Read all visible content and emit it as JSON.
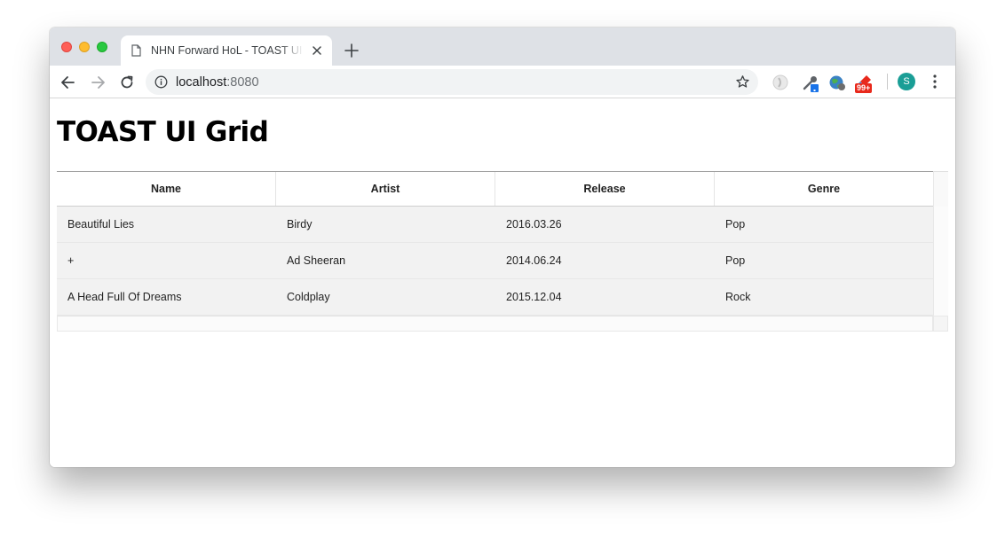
{
  "browser": {
    "tab": {
      "title": "NHN Forward HoL - TOAST UI Grid"
    },
    "address_bar": {
      "host": "localhost",
      "port": ":8080"
    },
    "extension_badge": "99+",
    "profile_initial": "S"
  },
  "page": {
    "title": "TOAST UI Grid"
  },
  "grid": {
    "columns": [
      "Name",
      "Artist",
      "Release",
      "Genre"
    ],
    "rows": [
      [
        "Beautiful Lies",
        "Birdy",
        "2016.03.26",
        "Pop"
      ],
      [
        "+",
        "Ad Sheeran",
        "2014.06.24",
        "Pop"
      ],
      [
        "A Head Full Of Dreams",
        "Coldplay",
        "2015.12.04",
        "Rock"
      ]
    ]
  },
  "colors": {
    "tabstrip": "#dee1e6",
    "omnibox": "#f1f3f4",
    "row_background": "#f2f2f2",
    "avatar": "#1a9e96",
    "badge": "#e8291c"
  },
  "icons": [
    "page-icon",
    "close-icon",
    "plus-icon",
    "back-arrow-icon",
    "forward-arrow-icon",
    "reload-icon",
    "info-icon",
    "star-icon",
    "extension-icons",
    "profile-avatar",
    "kebab-menu-icon"
  ]
}
